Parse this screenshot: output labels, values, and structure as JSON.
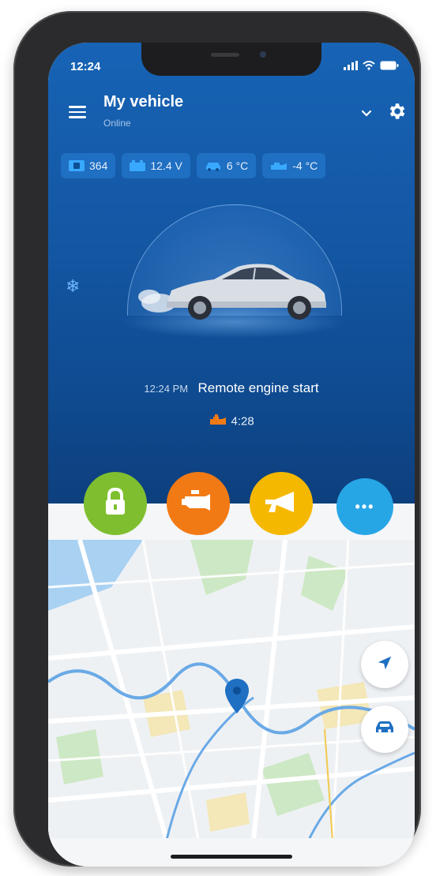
{
  "status_bar": {
    "time": "12:24"
  },
  "header": {
    "title": "My vehicle",
    "subtitle": "Online"
  },
  "metrics": [
    {
      "icon": "card-icon",
      "value": "364"
    },
    {
      "icon": "battery-icon",
      "value": "12.4 V"
    },
    {
      "icon": "car-interior-temp-icon",
      "value": "6 °C"
    },
    {
      "icon": "engine-temp-icon",
      "value": "-4 °C"
    }
  ],
  "event": {
    "time": "12:24 PM",
    "label": "Remote engine start"
  },
  "timer": {
    "value": "4:28"
  },
  "actions": [
    {
      "name": "lock",
      "icon": "lock-icon",
      "color": "#7fbf2f"
    },
    {
      "name": "engine",
      "icon": "engine-icon",
      "color": "#f27a14"
    },
    {
      "name": "horn",
      "icon": "horn-icon",
      "color": "#f5b800"
    },
    {
      "name": "more",
      "icon": "more-icon",
      "label": "•••",
      "color": "#27a6e6"
    }
  ],
  "colors": {
    "hero_top": "#1763b5",
    "hero_bottom": "#0d3f7d",
    "chip_bg": "#1f6fc2",
    "accent_blue": "#27a6e6"
  }
}
